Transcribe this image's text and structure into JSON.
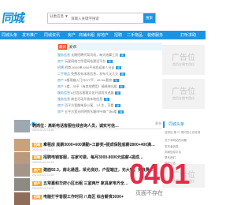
{
  "header": {
    "logo": "同城",
    "search": {
      "category": "分类信息 ▼",
      "placeholder": "请输入关键字搜索",
      "button": "搜索"
    }
  },
  "nav": {
    "items": [
      "同城头条",
      "发布推广",
      "同城资讯",
      "房产",
      "商铺出租",
      "房地产",
      "招聘",
      "二手物品",
      "装修服务",
      "打听求助"
    ]
  },
  "featured": {
    "tag": "最新",
    "title": "发布",
    "rows": [
      {
        "cat": "服务信息",
        "text": "长期招聘代驾司机，每天结算工资",
        "badge": "新"
      },
      {
        "cat": "房产",
        "text": "玩星网络工作室网站建设平台",
        "badge": "新"
      },
      {
        "cat": "招聘",
        "text": "招商-5000单1000平米欢迎来人洽谈",
        "badge": "新"
      },
      {
        "cat": "二手物品",
        "text": "免费发布本地信息，发布几天几天",
        "badge": "新"
      },
      {
        "cat": "房产",
        "text": "5楼现箱入门口077平，45.9m套房",
        "badge": "新"
      },
      {
        "cat": "房产",
        "text": "1楼、35平（有其他费用）精装修出租",
        "badge": "新"
      },
      {
        "cat": "服务信息",
        "text": "8日宫店客客文化开游戏节进展",
        "badge": "新"
      },
      {
        "cat": "服务信息",
        "text": "商会活动开放本地信息",
        "badge": "新"
      },
      {
        "cat": "房产",
        "text": "百平方宽敞单身公寓，1人生，可看",
        "badge": "新"
      },
      {
        "cat": "房产",
        "text": "五平方宽光时明到东塘市中海广场4楼",
        "badge": "新"
      },
      {
        "cat": "二手物品",
        "text": "卖全新红木顶头电竞椅",
        "badge": "新"
      },
      {
        "cat": "房产",
        "text": "南北通透清新小区精装修房出租",
        "badge": "新"
      }
    ]
  },
  "ads": [
    {
      "big": "广告位",
      "small": "首页左侧专用位"
    },
    {
      "big": "广告位",
      "small": "首页左侧专用位"
    },
    {
      "big": "广告位",
      "small": "首页左侧专用位"
    }
  ],
  "news": {
    "title": "同城头条",
    "more": "更多",
    "items": [
      {
        "title": "聘岗位：高新电话客服在线咨询人员，诚实可信…",
        "date": "2023-03-21 11:16",
        "tag": ""
      },
      {
        "title": "拿租房 底薪3000+600满勤+工龄奖+提成保险底薪2800+400满…",
        "date": "2023-03-21 11:14",
        "tag": "招聘"
      },
      {
        "title": "招聘电销客服，在家可做，每月3000-8000元底薪+提成…",
        "date": "2023-03-21 11:13",
        "tag": "招聘"
      },
      {
        "title": "建面92.3，南北通透，采光良好，户型端正，无大窗，无浪费…",
        "date": "2023-03-21 11:10",
        "tag": "房产"
      },
      {
        "title": "五常嘉和华府小区出租 三室两厅 家具家电齐全…",
        "date": "2023-03-21 11:08",
        "tag": "房产"
      },
      {
        "title": "电脑打字客服工作时间 八角区 综合薪资3000+",
        "date": "2023-03-21 11:05",
        "tag": "招聘"
      }
    ]
  },
  "sidebar_news": {
    "title": "同城头条",
    "lines": [
      "西坝区 第 27 周问答汇总收到",
      "关于本网站的问题",
      "发布者信息",
      "同城信息平台",
      "联系我们",
      "网站公告"
    ]
  },
  "watermark": {
    "code": "0401",
    "sub": "页面不存在"
  }
}
